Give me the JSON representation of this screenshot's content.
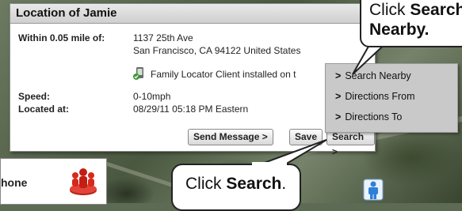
{
  "popup": {
    "title": "Location of Jamie",
    "within_label": "Within 0.05 mile of:",
    "address_line1": "1137 25th Ave",
    "address_line2": "San Francisco, CA 94122 United States",
    "client_text": "Family Locator Client installed on t",
    "speed_label": "Speed:",
    "speed_value": "0-10mph",
    "located_label": "Located at:",
    "located_value": "08/29/11 05:18 PM Eastern"
  },
  "buttons": {
    "send_message": "Send Message >",
    "save": "Save",
    "search": "Search >"
  },
  "menu": {
    "items": [
      {
        "label": "Search Nearby"
      },
      {
        "label": "Directions From"
      },
      {
        "label": "Directions To"
      }
    ],
    "arrow": ">"
  },
  "side_panel": {
    "text": "hone"
  },
  "callouts": {
    "top_line1_prefix": "Click ",
    "top_line1_bold": "Search",
    "top_line2_bold": "Nearby",
    "top_line2_suffix": ".",
    "bottom_prefix": "Click ",
    "bottom_bold": "Search",
    "bottom_suffix": "."
  },
  "icons": {
    "client": "phone-client-icon",
    "people": "people-group-icon",
    "marker": "person-marker-icon"
  },
  "colors": {
    "marker_blue": "#2f7fd8",
    "people_red": "#d8281c",
    "client_green": "#3d9a3a"
  }
}
